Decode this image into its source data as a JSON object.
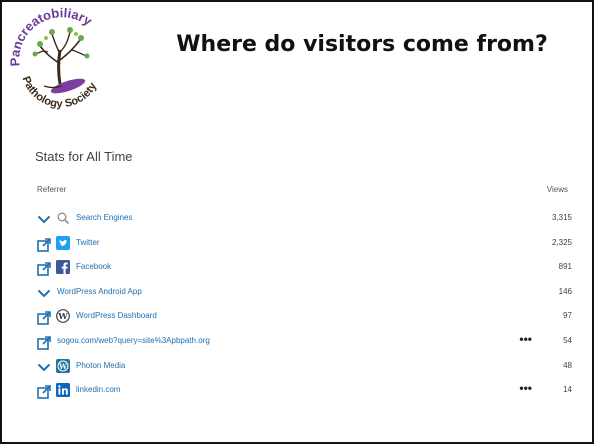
{
  "slide": {
    "title": "Where do visitors come from?",
    "logo": {
      "top_text": "Pancreatobiliary",
      "bottom_text": "Pathology Society",
      "colors": {
        "text_purple": "#6b3a97",
        "text_green": "#5aa83a",
        "tree_green": "#6aa84f",
        "trunk": "#3a2a1a",
        "leaf_purple": "#7b3fa0"
      }
    }
  },
  "stats": {
    "heading": "Stats for All Time",
    "col_referrer": "Referrer",
    "col_views": "Views",
    "rows": [
      {
        "label": "Search Engines",
        "value": "3,315",
        "lead": "chevron-down",
        "icon": "search",
        "more": ""
      },
      {
        "label": "Twitter",
        "value": "2,325",
        "lead": "external-link",
        "icon": "twitter",
        "more": ""
      },
      {
        "label": "Facebook",
        "value": "891",
        "lead": "external-link",
        "icon": "facebook",
        "more": ""
      },
      {
        "label": "WordPress Android App",
        "value": "146",
        "lead": "chevron-down",
        "icon": "",
        "more": ""
      },
      {
        "label": "WordPress Dashboard",
        "value": "97",
        "lead": "external-link",
        "icon": "wordpress",
        "more": ""
      },
      {
        "label": "sogou.com/web?query=site%3Apbpath.org",
        "value": "54",
        "lead": "external-link",
        "icon": "",
        "more": "•••"
      },
      {
        "label": "Photon Media",
        "value": "48",
        "lead": "chevron-down",
        "icon": "wordpress-square",
        "more": ""
      },
      {
        "label": "linkedin.com",
        "value": "14",
        "lead": "external-link",
        "icon": "linkedin",
        "more": "•••"
      }
    ],
    "colors": {
      "link": "#2271b1",
      "twitter": "#1da1f2",
      "facebook": "#3b5998",
      "linkedin": "#0a66c2",
      "wordpress": "#21759b"
    }
  }
}
